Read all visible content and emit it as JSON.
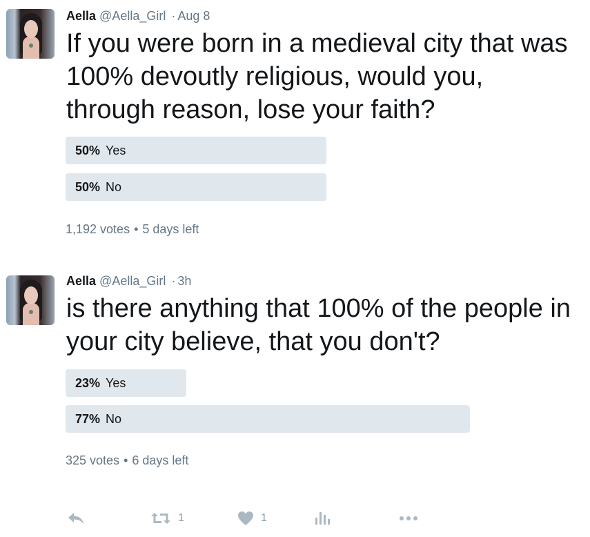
{
  "tweets": [
    {
      "author_name": "Aella",
      "author_handle": "@Aella_Girl",
      "separator": "·",
      "time": "Aug 8",
      "text": "If you were born in a medieval city that was 100% devoutly religious, would you, through reason, lose your faith?",
      "poll": {
        "options": [
          {
            "percent_label": "50%",
            "label": "Yes",
            "fraction": 0.5
          },
          {
            "percent_label": "50%",
            "label": "No",
            "fraction": 0.5
          }
        ],
        "votes": "1,192 votes",
        "bullet": "•",
        "time_left": "5 days left"
      }
    },
    {
      "author_name": "Aella",
      "author_handle": "@Aella_Girl",
      "separator": "·",
      "time": "3h",
      "text": "is there anything that 100% of the people in your city believe, that you don't?",
      "poll": {
        "options": [
          {
            "percent_label": "23%",
            "label": "Yes",
            "fraction": 0.23
          },
          {
            "percent_label": "77%",
            "label": "No",
            "fraction": 0.77
          }
        ],
        "votes": "325 votes",
        "bullet": "•",
        "time_left": "6 days left"
      }
    }
  ],
  "actions": {
    "reply_icon": "reply-icon",
    "retweet_icon": "retweet-icon",
    "retweet_count": "1",
    "like_icon": "heart-icon",
    "like_count": "1",
    "analytics_icon": "analytics-icon",
    "more_icon": "more-icon"
  },
  "colors": {
    "text": "#14171a",
    "muted": "#657786",
    "poll_bar": "#e1e8ed",
    "action_icon": "#aab8c2"
  }
}
